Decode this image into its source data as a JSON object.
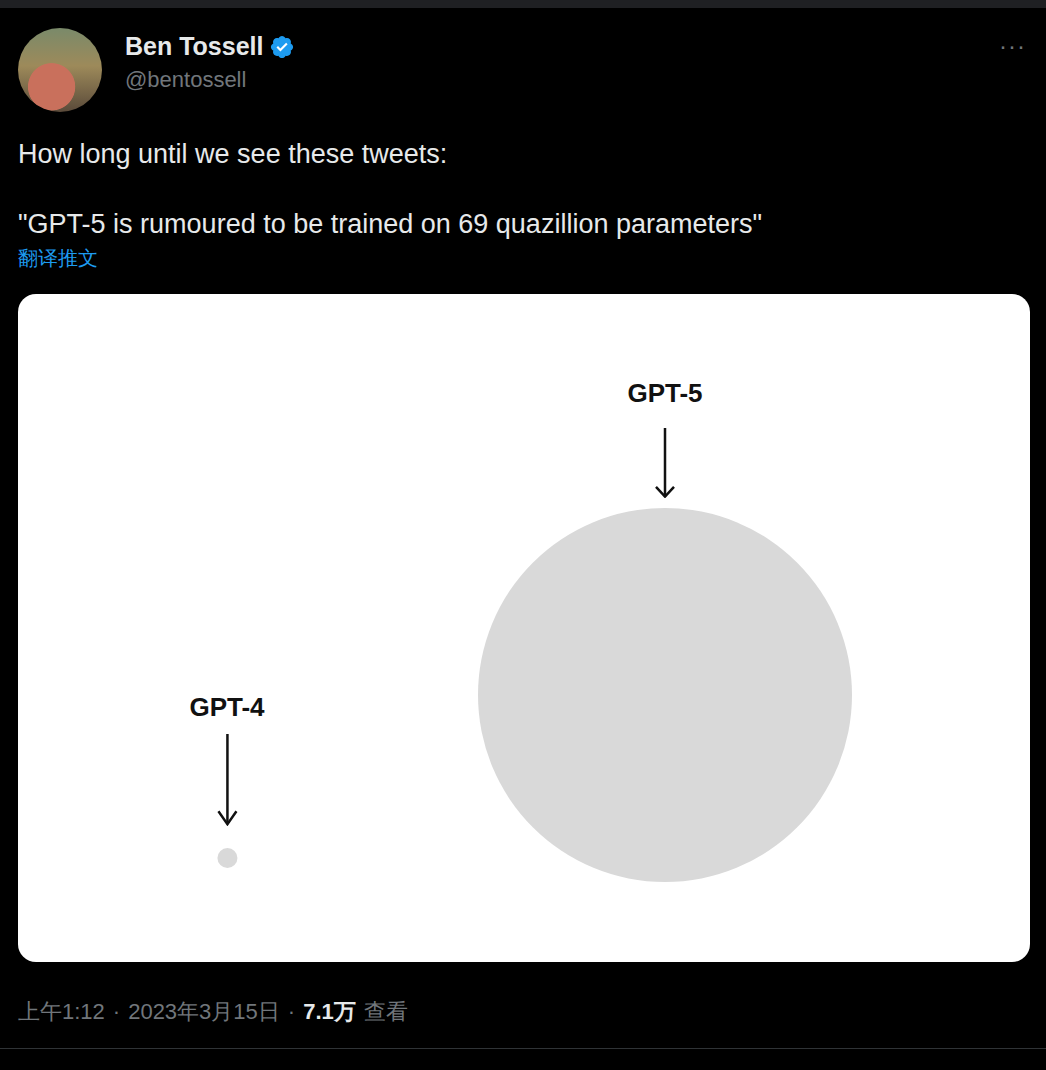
{
  "author": {
    "name": "Ben Tossell",
    "handle": "@bentossell",
    "verified": true
  },
  "more": "···",
  "tweet": {
    "lines": [
      "How long until we see these tweets:",
      "\"GPT-5 is rumoured to be trained on 69 quazillion parameters\""
    ],
    "translate": "翻译推文"
  },
  "image": {
    "items": [
      {
        "label": "GPT-4",
        "kind": "small"
      },
      {
        "label": "GPT-5",
        "kind": "large"
      }
    ]
  },
  "meta": {
    "time": "上午1:12",
    "separator": "·",
    "date": "2023年3月15日",
    "views": "7.1万",
    "views_label": "查看"
  }
}
